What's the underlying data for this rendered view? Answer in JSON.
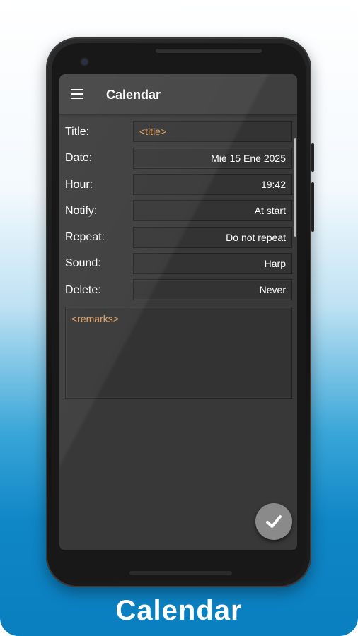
{
  "app": {
    "title": "Calendar",
    "menu_icon": "hamburger-menu-icon"
  },
  "form": {
    "rows": [
      {
        "label": "Title:",
        "value": "<title>",
        "placeholder": true
      },
      {
        "label": "Date:",
        "value": "Mié 15 Ene 2025",
        "placeholder": false
      },
      {
        "label": "Hour:",
        "value": "19:42",
        "placeholder": false
      },
      {
        "label": "Notify:",
        "value": "At start",
        "placeholder": false
      },
      {
        "label": "Repeat:",
        "value": "Do not repeat",
        "placeholder": false
      },
      {
        "label": "Sound:",
        "value": "Harp",
        "placeholder": false
      },
      {
        "label": "Delete:",
        "value": "Never",
        "placeholder": false
      }
    ],
    "remarks_placeholder": "<remarks>"
  },
  "fab": {
    "icon": "checkmark-icon"
  },
  "caption": "Calendar",
  "colors": {
    "accent_placeholder": "#e0a060",
    "background_top": "#ffffff",
    "background_bottom": "#0a7fc0",
    "screen": "#383838",
    "appbar": "#3f3f3f"
  }
}
